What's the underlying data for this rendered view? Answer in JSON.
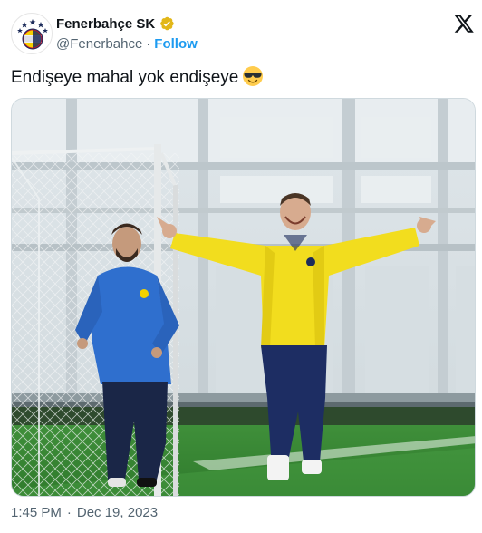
{
  "author": {
    "display_name": "Fenerbahçe SK",
    "handle": "@Fenerbahce",
    "separator": "·",
    "follow_label": "Follow",
    "verified": true,
    "badge_color": "#e2b719"
  },
  "platform_icon": "x-logo-icon",
  "tweet": {
    "text": "Endişeye mahal yok endişeye",
    "emoji": "smiling-face-with-sunglasses-icon"
  },
  "media": {
    "kind": "photo"
  },
  "meta": {
    "time": "1:45 PM",
    "separator": "·",
    "date": "Dec 19, 2023"
  },
  "colors": {
    "follow": "#1d9bf0",
    "secondary_text": "#536471",
    "primary_text": "#0f1419"
  }
}
